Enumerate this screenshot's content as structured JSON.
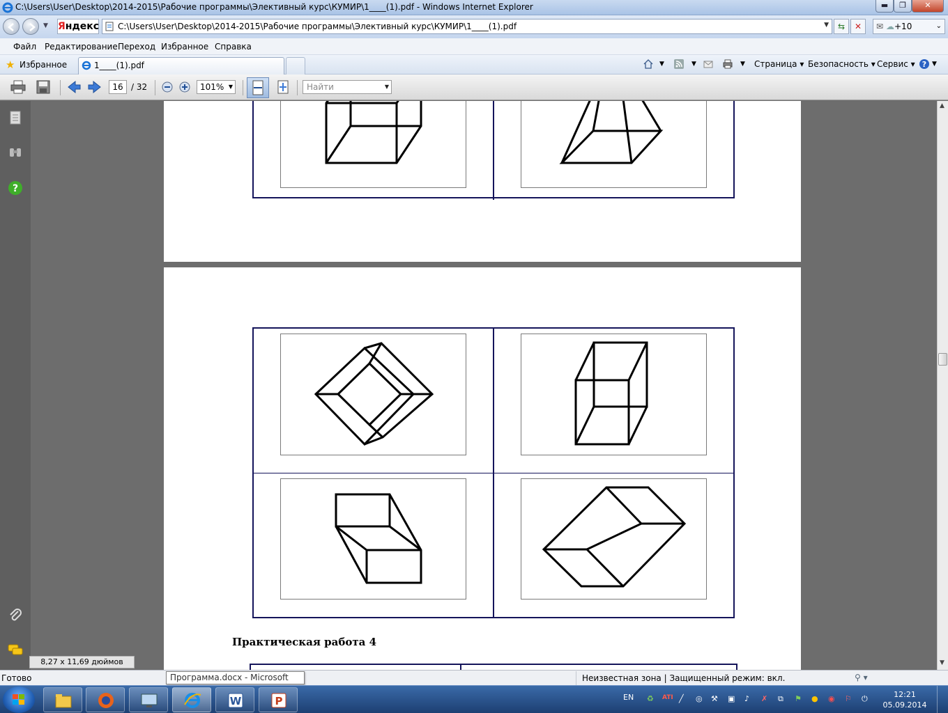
{
  "window": {
    "title": "C:\\Users\\User\\Desktop\\2014-2015\\Рабочие программы\\Элективный курс\\КУМИР\\1____(1).pdf - Windows Internet Explorer",
    "min_label": "▬",
    "max_label": "❐",
    "close_label": "✕"
  },
  "addressbar": {
    "yandex_first": "Я",
    "yandex_rest": "ндекс",
    "url": "C:\\Users\\User\\Desktop\\2014-2015\\Рабочие программы\\Элективный курс\\КУМИР\\1____(1).pdf",
    "weather": "+10"
  },
  "menu": {
    "items": [
      "Файл",
      "Редактирование",
      "Переход",
      "Избранное",
      "Справка"
    ]
  },
  "favorites": {
    "label": "Избранное",
    "tab_title": "1____(1).pdf"
  },
  "commandbar": {
    "page": "Страница",
    "safety": "Безопасность",
    "service": "Сервис"
  },
  "pdf_toolbar": {
    "current_page": "16",
    "total_pages": "/ 32",
    "zoom": "101%",
    "find_placeholder": "Найти"
  },
  "document": {
    "heading": "Практическая работа 4",
    "page_size": "8,27 x 11,69 дюймов"
  },
  "status": {
    "ready": "Готово",
    "tooltip": "Программа.docx - Microsoft Word",
    "zone": "Неизвестная зона | Защищенный режим: вкл."
  },
  "taskbar": {
    "lang": "EN",
    "time": "12:21",
    "date": "05.09.2014"
  }
}
